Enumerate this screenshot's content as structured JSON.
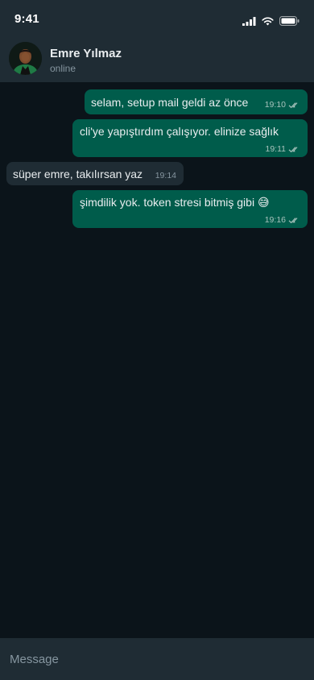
{
  "status_bar": {
    "time": "9:41"
  },
  "chat_header": {
    "contact_name": "Emre Yılmaz",
    "contact_status": "online",
    "avatar_icon": "person-avatar-icon"
  },
  "messages": [
    {
      "direction": "outgoing",
      "text": "selam, setup mail geldi az önce",
      "time": "19:10",
      "status": "read"
    },
    {
      "direction": "outgoing",
      "text": "cli'ye yapıştırdım çalışıyor. elinize sağlık",
      "time": "19:11",
      "status": "read"
    },
    {
      "direction": "incoming",
      "text": "süper emre, takılırsan yaz",
      "time": "19:14"
    },
    {
      "direction": "outgoing",
      "text": "şimdilik yok. token stresi bitmiş gibi 😅",
      "time": "19:16",
      "status": "read"
    }
  ],
  "composer": {
    "placeholder": "Message"
  },
  "colors": {
    "background": "#0b141a",
    "header": "#1f2c34",
    "outgoing_bubble": "#005c4b",
    "incoming_bubble": "#1f2c34",
    "secondary_text": "#8696a0"
  }
}
